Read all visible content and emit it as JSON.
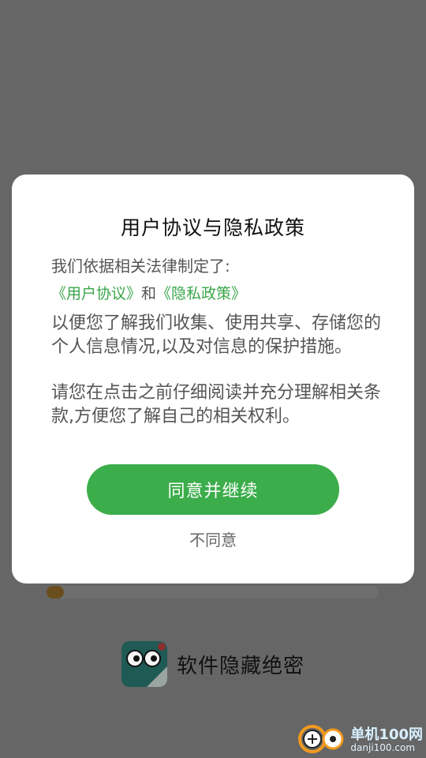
{
  "dialog": {
    "title": "用户协议与隐私政策",
    "intro": "我们依据相关法律制定了:",
    "user_agreement_link": "《用户协议》",
    "and_text": "和",
    "privacy_policy_link": "《隐私政策》",
    "paragraph_1": "以便您了解我们收集、使用共享、存储您的个人信息情况,以及对信息的保护措施。",
    "paragraph_2": "请您在点击之前仔细阅读并充分理解相关条款,方便您了解自己的相关权利。",
    "agree_label": "同意并继续",
    "disagree_label": "不同意"
  },
  "splash": {
    "app_name": "软件隐藏绝密",
    "progress_fraction": 0.05
  },
  "watermark": {
    "line1": "单机100网",
    "line2": "danji100.com"
  },
  "colors": {
    "accent": "#3cad4b",
    "link": "#3aa64a",
    "overlay": "#666666",
    "progress_fill": "#6a4d1d"
  },
  "icons": {
    "app_icon": "app-eyes-icon",
    "watermark_logo": "danji-logo-icon"
  }
}
